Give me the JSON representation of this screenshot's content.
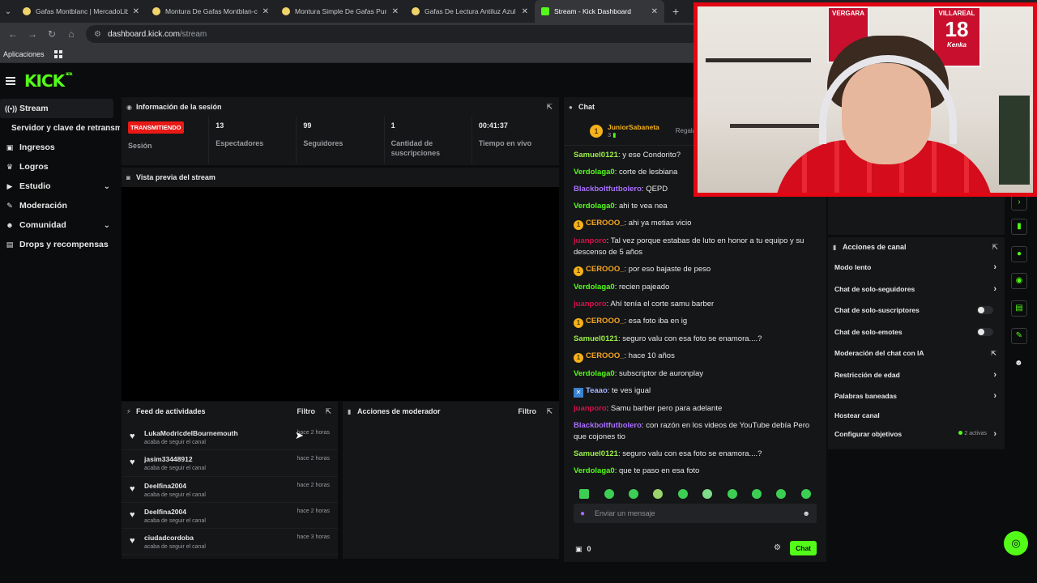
{
  "browser": {
    "tabs": [
      {
        "title": "Gafas Montblanc | MercadoLib",
        "active": false
      },
      {
        "title": "Montura De Gafas Montblan-c",
        "active": false
      },
      {
        "title": "Montura Simple De Gafas Pura",
        "active": false
      },
      {
        "title": "Gafas De Lectura Antiluz Azul C",
        "active": false
      },
      {
        "title": "Stream - Kick Dashboard",
        "active": true
      }
    ],
    "url_site": "dashboard.kick.com",
    "url_path": "/stream",
    "bookmarks_label": "Aplicaciones"
  },
  "header": {
    "logo": "KICK",
    "beta": "BETA"
  },
  "sidebar": {
    "items": [
      {
        "label": "Stream",
        "icon": "broadcast-icon",
        "active": true
      },
      {
        "label": "Servidor y clave de retransmisión",
        "sub": true
      },
      {
        "label": "Ingresos",
        "icon": "money-icon"
      },
      {
        "label": "Logros",
        "icon": "trophy-icon"
      },
      {
        "label": "Estudio",
        "icon": "video-icon",
        "expand": true
      },
      {
        "label": "Moderación",
        "icon": "wrench-icon"
      },
      {
        "label": "Comunidad",
        "icon": "people-icon",
        "expand": true
      },
      {
        "label": "Drops y recompensas",
        "icon": "gift-icon"
      }
    ]
  },
  "session": {
    "title": "Información de la sesión",
    "status_badge": "TRANSMITIENDO",
    "status_label": "Sesión",
    "viewers": "13",
    "viewers_label": "Espectadores",
    "followers": "99",
    "followers_label": "Seguidores",
    "subs": "1",
    "subs_label": "Cantidad de suscripciones",
    "live_time": "00:41:37",
    "live_time_label": "Tiempo en vivo"
  },
  "preview": {
    "title": "Vista previa del stream"
  },
  "feed": {
    "title": "Feed de actividades",
    "filter": "Filtro",
    "rows": [
      {
        "name": "LukaModricdelBournemouth",
        "sub": "acaba de seguir el canal",
        "time": "hace 2 horas"
      },
      {
        "name": "jasim33448912",
        "sub": "acaba de seguir el canal",
        "time": "hace 2 horas"
      },
      {
        "name": "Deelfina2004",
        "sub": "acaba de seguir el canal",
        "time": "hace 2 horas"
      },
      {
        "name": "Deelfina2004",
        "sub": "acaba de seguir el canal",
        "time": "hace 2 horas"
      },
      {
        "name": "ciudadcordoba",
        "sub": "acaba de seguir el canal",
        "time": "hace 3 horas"
      }
    ]
  },
  "mod_actions": {
    "title": "Acciones de moderador",
    "filter": "Filtro"
  },
  "chat": {
    "title": "Chat",
    "pinned_user": "JuniorSabaneta",
    "pinned_count": "3",
    "pinned_action": "Regala",
    "messages": [
      {
        "user": "Samuel0121",
        "text": "y ese Condorito?",
        "color": "#9cf04a"
      },
      {
        "user": "Verdolaga0",
        "text": "corte de lesbiana",
        "color": "#53fc18"
      },
      {
        "user": "Blackboltfutbolero",
        "text": "QEPD",
        "color": "#a970ff"
      },
      {
        "user": "Verdolaga0",
        "text": "ahi te vea nea",
        "color": "#53fc18"
      },
      {
        "user": "CEROOO_",
        "text": "ahi ya metias vicio",
        "color": "#f5a623",
        "badge": "1"
      },
      {
        "user": "juanporo",
        "text": "Tal vez porque estabas de luto en honor a tu equipo y su descenso de 5 años",
        "color": "#d2124a"
      },
      {
        "user": "CEROOO_",
        "text": "por eso bajaste de peso",
        "color": "#f5a623",
        "badge": "1"
      },
      {
        "user": "Verdolaga0",
        "text": "recien pajeado",
        "color": "#53fc18"
      },
      {
        "user": "juanporo",
        "text": "Ahí tenía el corte samu barber",
        "color": "#d2124a"
      },
      {
        "user": "CEROOO_",
        "text": "esa foto iba en ig",
        "color": "#f5a623",
        "badge": "1"
      },
      {
        "user": "Samuel0121",
        "text": "seguro valu con esa foto se enamora....?",
        "color": "#9cf04a"
      },
      {
        "user": "CEROOO_",
        "text": "hace 10 años",
        "color": "#f5a623",
        "badge": "1"
      },
      {
        "user": "Verdolaga0",
        "text": "subscriptor de auronplay",
        "color": "#53fc18"
      },
      {
        "user": "Teaao",
        "text": "te ves igual",
        "color": "#a6b6ff",
        "badgeb": true
      },
      {
        "user": "juanporo",
        "text": "Samu barber pero para adelante",
        "color": "#d2124a"
      },
      {
        "user": "Blackboltfutbolero",
        "text": "con razón en los videos de YouTube debía Pero que cojones tio",
        "color": "#a970ff"
      },
      {
        "user": "Samuel0121",
        "text": "seguro valu con esa foto se enamora....?",
        "color": "#9cf04a"
      },
      {
        "user": "Verdolaga0",
        "text": "que te paso en esa foto",
        "color": "#53fc18"
      }
    ],
    "input_placeholder": "Enviar un mensaje",
    "points": "0",
    "send_label": "Chat"
  },
  "channel_actions": {
    "title": "Acciones de canal",
    "rows": [
      {
        "label": "Modo lento",
        "kind": "chevron"
      },
      {
        "label": "Chat de solo-seguidores",
        "kind": "chevron"
      },
      {
        "label": "Chat de solo-suscriptores",
        "kind": "toggle"
      },
      {
        "label": "Chat de solo-emotes",
        "kind": "toggle"
      },
      {
        "label": "Moderación del chat con IA",
        "kind": "external"
      },
      {
        "label": "Restricción de edad",
        "kind": "chevron"
      },
      {
        "label": "Palabras baneadas",
        "kind": "chevron"
      },
      {
        "label": "Hostear canal",
        "kind": "none"
      },
      {
        "label": "Configurar objetivos",
        "kind": "chevron",
        "active": "2 activas"
      }
    ]
  },
  "webcam": {
    "poster_left_text": "VERGARA",
    "poster_right_text": "VILLAREAL",
    "poster_right_number": "18",
    "poster_right_name": "Kenka"
  },
  "colors": {
    "kick_green": "#53fc18",
    "live_red": "#e91916",
    "cam_border": "#e30613"
  }
}
